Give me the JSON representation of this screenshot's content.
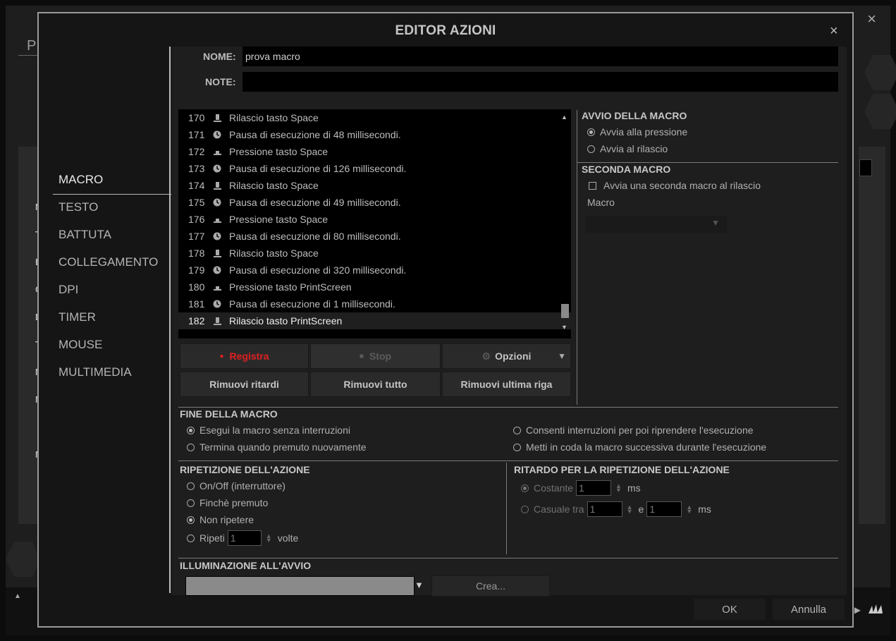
{
  "background": {
    "title_fragment": "PR",
    "side_letters": [
      "M",
      "T",
      "B",
      "C",
      "D",
      "T",
      "M",
      "M",
      "",
      "M"
    ]
  },
  "dialog": {
    "title": "EDITOR AZIONI",
    "close": "×",
    "bg_close": "×"
  },
  "nav": {
    "items": [
      "MACRO",
      "TESTO",
      "BATTUTA",
      "COLLEGAMENTO",
      "DPI",
      "TIMER",
      "MOUSE",
      "MULTIMEDIA"
    ]
  },
  "fields": {
    "name_label": "NOME:",
    "name_value": "prova macro",
    "note_label": "NOTE:",
    "note_value": ""
  },
  "macro_list": {
    "rows": [
      {
        "num": "170",
        "icon": "key-release",
        "text": "Rilascio tasto Space"
      },
      {
        "num": "171",
        "icon": "clock",
        "text": "Pausa di esecuzione di 48 millisecondi."
      },
      {
        "num": "172",
        "icon": "key-press",
        "text": "Pressione tasto Space"
      },
      {
        "num": "173",
        "icon": "clock",
        "text": "Pausa di esecuzione di 126 millisecondi."
      },
      {
        "num": "174",
        "icon": "key-release",
        "text": "Rilascio tasto Space"
      },
      {
        "num": "175",
        "icon": "clock",
        "text": "Pausa di esecuzione di 49 millisecondi."
      },
      {
        "num": "176",
        "icon": "key-press",
        "text": "Pressione tasto Space"
      },
      {
        "num": "177",
        "icon": "clock",
        "text": "Pausa di esecuzione di 80 millisecondi."
      },
      {
        "num": "178",
        "icon": "key-release",
        "text": "Rilascio tasto Space"
      },
      {
        "num": "179",
        "icon": "clock",
        "text": "Pausa di esecuzione di 320 millisecondi."
      },
      {
        "num": "180",
        "icon": "key-press",
        "text": "Pressione tasto PrintScreen"
      },
      {
        "num": "181",
        "icon": "clock",
        "text": "Pausa di esecuzione di 1 millisecondi."
      },
      {
        "num": "182",
        "icon": "key-release",
        "text": "Rilascio tasto PrintScreen",
        "selected": true
      }
    ]
  },
  "buttons": {
    "record": "Registra",
    "stop": "Stop",
    "options": "Opzioni",
    "remove_delays": "Rimuovi ritardi",
    "remove_all": "Rimuovi tutto",
    "remove_last": "Rimuovi ultima riga"
  },
  "start": {
    "heading": "AVVIO DELLA MACRO",
    "on_press": "Avvia alla pressione",
    "on_release": "Avvia al rilascio"
  },
  "second": {
    "heading": "SECONDA MACRO",
    "checkbox": "Avvia una seconda macro al rilascio",
    "macro_label": "Macro"
  },
  "end": {
    "heading": "FINE DELLA MACRO",
    "opt1": "Esegui la macro senza interruzioni",
    "opt2": "Termina quando premuto nuovamente",
    "opt3": "Consenti interruzioni per poi riprendere l'esecuzione",
    "opt4": "Metti in coda la macro successiva durante l'esecuzione"
  },
  "repeat": {
    "heading": "RIPETIZIONE DELL'AZIONE",
    "toggle": "On/Off (interruttore)",
    "while_pressed": "Finchè premuto",
    "no_repeat": "Non ripetere",
    "repeat": "Ripeti",
    "repeat_count": "1",
    "times": "volte"
  },
  "delay": {
    "heading": "RITARDO PER LA RIPETIZIONE DELL'AZIONE",
    "constant": "Costante",
    "constant_value": "1",
    "ms": "ms",
    "random": "Casuale tra",
    "random_min": "1",
    "and": "e",
    "random_max": "1"
  },
  "lighting": {
    "heading": "ILLUMINAZIONE ALL'AVVIO",
    "create": "Crea..."
  },
  "footer": {
    "ok": "OK",
    "cancel": "Annulla"
  },
  "colors": {
    "record_red": "#e02020",
    "dialog_bg": "#151515",
    "panel_bg": "#1e1e1e"
  }
}
